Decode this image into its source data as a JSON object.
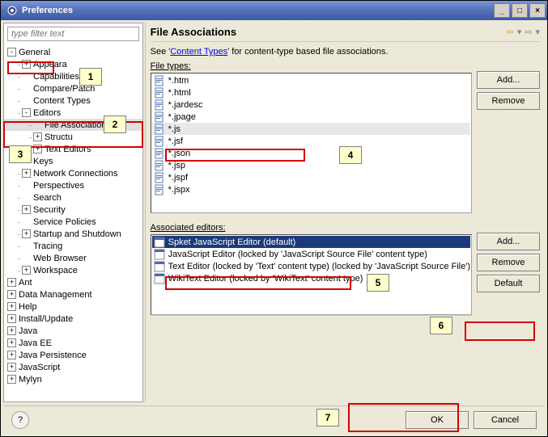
{
  "window": {
    "title": "Preferences"
  },
  "filter": {
    "placeholder": "type filter text"
  },
  "tree": [
    {
      "lvl": 0,
      "tw": "-",
      "label": "General"
    },
    {
      "lvl": 1,
      "tw": "+",
      "label": "Appearance",
      "trunc": true
    },
    {
      "lvl": 1,
      "tw": "",
      "label": "Capabilities"
    },
    {
      "lvl": 1,
      "tw": "",
      "label": "Compare/Patch"
    },
    {
      "lvl": 1,
      "tw": "",
      "label": "Content Types"
    },
    {
      "lvl": 1,
      "tw": "-",
      "label": "Editors"
    },
    {
      "lvl": 2,
      "tw": "",
      "label": "File Associations",
      "sel": true
    },
    {
      "lvl": 2,
      "tw": "+",
      "label": "Structured Text Editor",
      "trunc": true
    },
    {
      "lvl": 2,
      "tw": "+",
      "label": "Text Editors"
    },
    {
      "lvl": 1,
      "tw": "",
      "label": "Keys"
    },
    {
      "lvl": 1,
      "tw": "+",
      "label": "Network Connections"
    },
    {
      "lvl": 1,
      "tw": "",
      "label": "Perspectives"
    },
    {
      "lvl": 1,
      "tw": "",
      "label": "Search"
    },
    {
      "lvl": 1,
      "tw": "+",
      "label": "Security"
    },
    {
      "lvl": 1,
      "tw": "",
      "label": "Service Policies"
    },
    {
      "lvl": 1,
      "tw": "+",
      "label": "Startup and Shutdown"
    },
    {
      "lvl": 1,
      "tw": "",
      "label": "Tracing"
    },
    {
      "lvl": 1,
      "tw": "",
      "label": "Web Browser"
    },
    {
      "lvl": 1,
      "tw": "+",
      "label": "Workspace"
    },
    {
      "lvl": 0,
      "tw": "+",
      "label": "Ant"
    },
    {
      "lvl": 0,
      "tw": "+",
      "label": "Data Management"
    },
    {
      "lvl": 0,
      "tw": "+",
      "label": "Help"
    },
    {
      "lvl": 0,
      "tw": "+",
      "label": "Install/Update"
    },
    {
      "lvl": 0,
      "tw": "+",
      "label": "Java"
    },
    {
      "lvl": 0,
      "tw": "+",
      "label": "Java EE"
    },
    {
      "lvl": 0,
      "tw": "+",
      "label": "Java Persistence"
    },
    {
      "lvl": 0,
      "tw": "+",
      "label": "JavaScript"
    },
    {
      "lvl": 0,
      "tw": "+",
      "label": "Mylyn"
    }
  ],
  "main": {
    "heading": "File Associations",
    "desc_prefix": "See '",
    "desc_link": "Content Types",
    "desc_suffix": "' for content-type based file associations.",
    "filetypes_label": "File types:",
    "editors_label": "Associated editors:",
    "filetypes": [
      "*.htm",
      "*.html",
      "*.jardesc",
      "*.jpage",
      "*.js",
      "*.jsf",
      "*.json",
      "*.jsp",
      "*.jspf",
      "*.jspx"
    ],
    "filetypes_selected": 4,
    "editors": [
      {
        "name": "Spket JavaScript Editor (default)",
        "sel": true
      },
      {
        "name": "JavaScript Editor (locked by 'JavaScript Source File' content type)"
      },
      {
        "name": "Text Editor (locked by 'Text' content type) (locked by 'JavaScript Source File')"
      },
      {
        "name": "WikiText Editor (locked by 'WikiText' content type)"
      }
    ],
    "buttons": {
      "add": "Add...",
      "remove": "Remove",
      "default": "Default"
    }
  },
  "dialog": {
    "ok": "OK",
    "cancel": "Cancel",
    "help": "?"
  },
  "callouts": {
    "1": "1",
    "2": "2",
    "3": "3",
    "4": "4",
    "5": "5",
    "6": "6",
    "7": "7"
  }
}
